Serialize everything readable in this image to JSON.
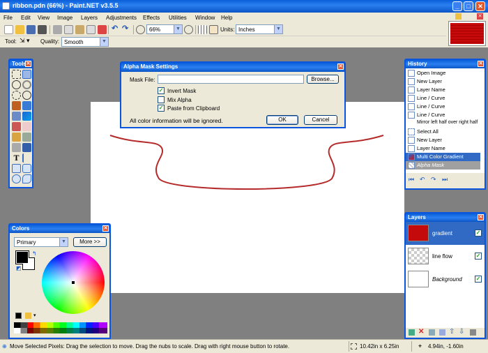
{
  "window": {
    "title": "ribbon.pdn (66%) - Paint.NET v3.5.5",
    "minimize": "_",
    "maximize": "□",
    "close": "✕"
  },
  "menu": [
    "File",
    "Edit",
    "View",
    "Image",
    "Layers",
    "Adjustments",
    "Effects",
    "Utilities",
    "Window",
    "Help"
  ],
  "toolbar": {
    "zoom_value": "66%",
    "units_label": "Units:",
    "units_value": "Inches",
    "tool_label": "Tool:",
    "quality_label": "Quality:",
    "quality_value": "Smooth"
  },
  "tools_panel": {
    "title": "Tools",
    "text_tool": "T"
  },
  "colors_panel": {
    "title": "Colors",
    "mode": "Primary",
    "more_button": "More >>"
  },
  "dialog": {
    "title": "Alpha Mask Settings",
    "mask_file_label": "Mask File:",
    "mask_file_value": "",
    "browse_button": "Browse...",
    "invert_mask": "Invert Mask",
    "mix_alpha": "Mix Alpha",
    "paste_clipboard": "Paste from Clipboard",
    "message": "All color information will be ignored.",
    "ok_button": "OK",
    "cancel_button": "Cancel",
    "checked": {
      "invert": true,
      "mix": false,
      "paste": true
    }
  },
  "history": {
    "title": "History",
    "items": [
      "Open Image",
      "New Layer",
      "Layer Name",
      "Line / Curve",
      "Line / Curve",
      "Line / Curve",
      "Mirror left half over right half",
      "Select All",
      "New Layer",
      "Layer Name",
      "Multi Color Gradient",
      "Alpha Mask"
    ],
    "selected_index": 10,
    "undone_index": 11
  },
  "layers": {
    "title": "Layers",
    "items": [
      {
        "name": "gradient",
        "visible": true,
        "selected": true
      },
      {
        "name": "line flow",
        "visible": true,
        "selected": false
      },
      {
        "name": "Background",
        "visible": true,
        "selected": false
      }
    ]
  },
  "status": {
    "message": "Move Selected Pixels: Drag the selection to move. Drag the nubs to scale. Drag with right mouse button to rotate.",
    "size": "10.42in x 6.25in",
    "position": "4.94in, -1.60in"
  },
  "colors": {
    "accent": "#0b54dd",
    "layer_red": "#c40a0a",
    "selected_row": "#316ac5"
  }
}
